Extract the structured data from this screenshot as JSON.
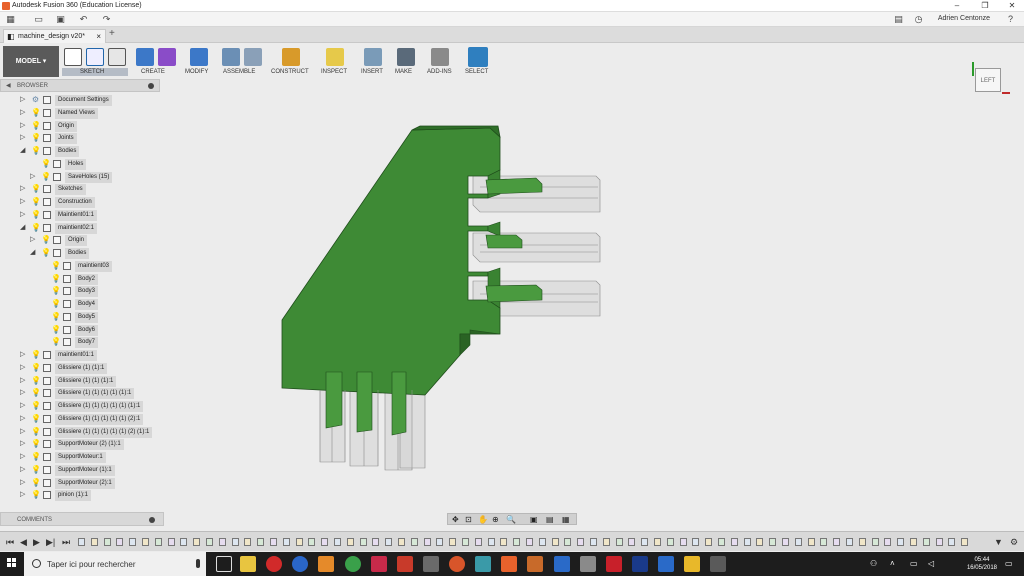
{
  "window": {
    "title": "Autodesk Fusion 360 (Education License)",
    "user": "Adrien Centonze",
    "doc_tab": "machine_design v20*"
  },
  "toolbar": {
    "workspace": "MODEL",
    "groups": [
      "SKETCH",
      "CREATE",
      "MODIFY",
      "ASSEMBLE",
      "CONSTRUCT",
      "INSPECT",
      "INSERT",
      "MAKE",
      "ADD-INS",
      "SELECT"
    ]
  },
  "browser": {
    "title": "BROWSER",
    "items": [
      {
        "label": "Document Settings",
        "depth": 0,
        "expanded": false,
        "icon": "gear"
      },
      {
        "label": "Named Views",
        "depth": 0,
        "expanded": false,
        "icon": "folder"
      },
      {
        "label": "Origin",
        "depth": 0,
        "expanded": false,
        "icon": "folder"
      },
      {
        "label": "Joints",
        "depth": 0,
        "expanded": false,
        "icon": "folder"
      },
      {
        "label": "Bodies",
        "depth": 0,
        "expanded": true,
        "icon": "folder"
      },
      {
        "label": "Holes",
        "depth": 1,
        "expanded": null,
        "icon": "folder",
        "on": true
      },
      {
        "label": "SaveHoles (15)",
        "depth": 1,
        "expanded": false,
        "icon": "folder"
      },
      {
        "label": "Sketches",
        "depth": 0,
        "expanded": false,
        "icon": "folder"
      },
      {
        "label": "Construction",
        "depth": 0,
        "expanded": false,
        "icon": "folder"
      },
      {
        "label": "Maintient01:1",
        "depth": 0,
        "expanded": false,
        "icon": "component"
      },
      {
        "label": "maintient02:1",
        "depth": 0,
        "expanded": true,
        "icon": "component",
        "on": true
      },
      {
        "label": "Origin",
        "depth": 1,
        "expanded": false,
        "icon": "folder"
      },
      {
        "label": "Bodies",
        "depth": 1,
        "expanded": true,
        "icon": "folder",
        "on": true
      },
      {
        "label": "maintient03",
        "depth": 2,
        "expanded": null,
        "icon": "body",
        "on": true
      },
      {
        "label": "Body2",
        "depth": 2,
        "expanded": null,
        "icon": "body",
        "on": true
      },
      {
        "label": "Body3",
        "depth": 2,
        "expanded": null,
        "icon": "body",
        "on": true
      },
      {
        "label": "Body4",
        "depth": 2,
        "expanded": null,
        "icon": "body",
        "on": true
      },
      {
        "label": "Body5",
        "depth": 2,
        "expanded": null,
        "icon": "body",
        "on": true
      },
      {
        "label": "Body6",
        "depth": 2,
        "expanded": null,
        "icon": "body",
        "on": true
      },
      {
        "label": "Body7",
        "depth": 2,
        "expanded": null,
        "icon": "body",
        "on": true
      },
      {
        "label": "maintient01:1",
        "depth": 0,
        "expanded": false,
        "icon": "component"
      },
      {
        "label": "Glissiere (1) (1):1",
        "depth": 0,
        "expanded": false,
        "icon": "component"
      },
      {
        "label": "Glissiere (1) (1) (1):1",
        "depth": 0,
        "expanded": false,
        "icon": "component"
      },
      {
        "label": "Glissiere (1) (1) (1) (1) (1):1",
        "depth": 0,
        "expanded": false,
        "icon": "component"
      },
      {
        "label": "Glissiere (1) (1) (1) (1) (1) (1):1",
        "depth": 0,
        "expanded": false,
        "icon": "component"
      },
      {
        "label": "Glissiere (1) (1) (1) (1) (1) (2):1",
        "depth": 0,
        "expanded": false,
        "icon": "component"
      },
      {
        "label": "Glissiere (1) (1) (1) (1) (1) (2) (1):1",
        "depth": 0,
        "expanded": false,
        "icon": "component"
      },
      {
        "label": "SupportMoteur (2) (1):1",
        "depth": 0,
        "expanded": false,
        "icon": "component"
      },
      {
        "label": "SupportMoteur:1",
        "depth": 0,
        "expanded": false,
        "icon": "component"
      },
      {
        "label": "SupportMoteur (1):1",
        "depth": 0,
        "expanded": false,
        "icon": "component"
      },
      {
        "label": "SupportMoteur (2):1",
        "depth": 0,
        "expanded": false,
        "icon": "component"
      },
      {
        "label": "pinion (1):1",
        "depth": 0,
        "expanded": false,
        "icon": "component"
      }
    ]
  },
  "comments": {
    "title": "COMMENTS"
  },
  "viewcube": {
    "face": "LEFT"
  },
  "taskbar": {
    "search_placeholder": "Taper ici pour rechercher",
    "time": "05:44",
    "date": "16/05/2018"
  },
  "colors": {
    "body_green": "#3e8a35",
    "body_green_dark": "#2a6324",
    "ghost": "#c8c8c8",
    "accent_blue": "#0078d7"
  }
}
